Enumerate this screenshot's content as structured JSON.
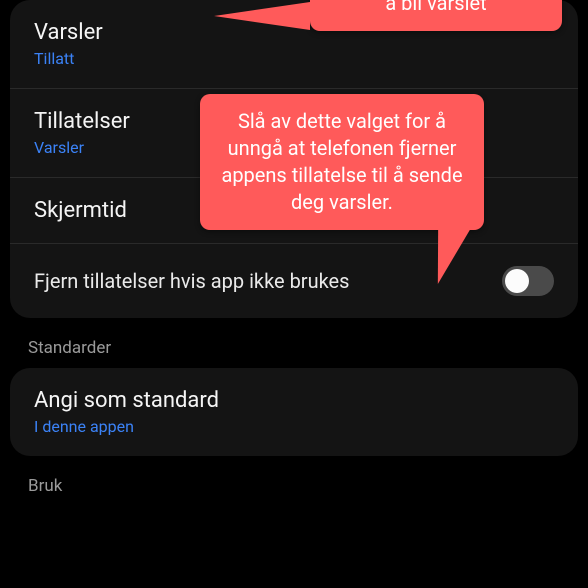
{
  "callouts": {
    "top": "å bli varslet",
    "mid": "Slå av dette valget for å unngå at telefonen fjerner appens tillatelse til å sende deg varsler."
  },
  "group1": {
    "varsler": {
      "title": "Varsler",
      "sub": "Tillatt"
    },
    "tillatelser": {
      "title": "Tillatelser",
      "sub": "Varsler"
    },
    "skjermtid": {
      "title": "Skjermtid"
    },
    "remove_perms": {
      "label": "Fjern tillatelser hvis app ikke brukes",
      "on": false
    }
  },
  "sections": {
    "standards": "Standarder",
    "usage": "Bruk"
  },
  "group2": {
    "default": {
      "title": "Angi som standard",
      "sub": "I denne appen"
    }
  }
}
